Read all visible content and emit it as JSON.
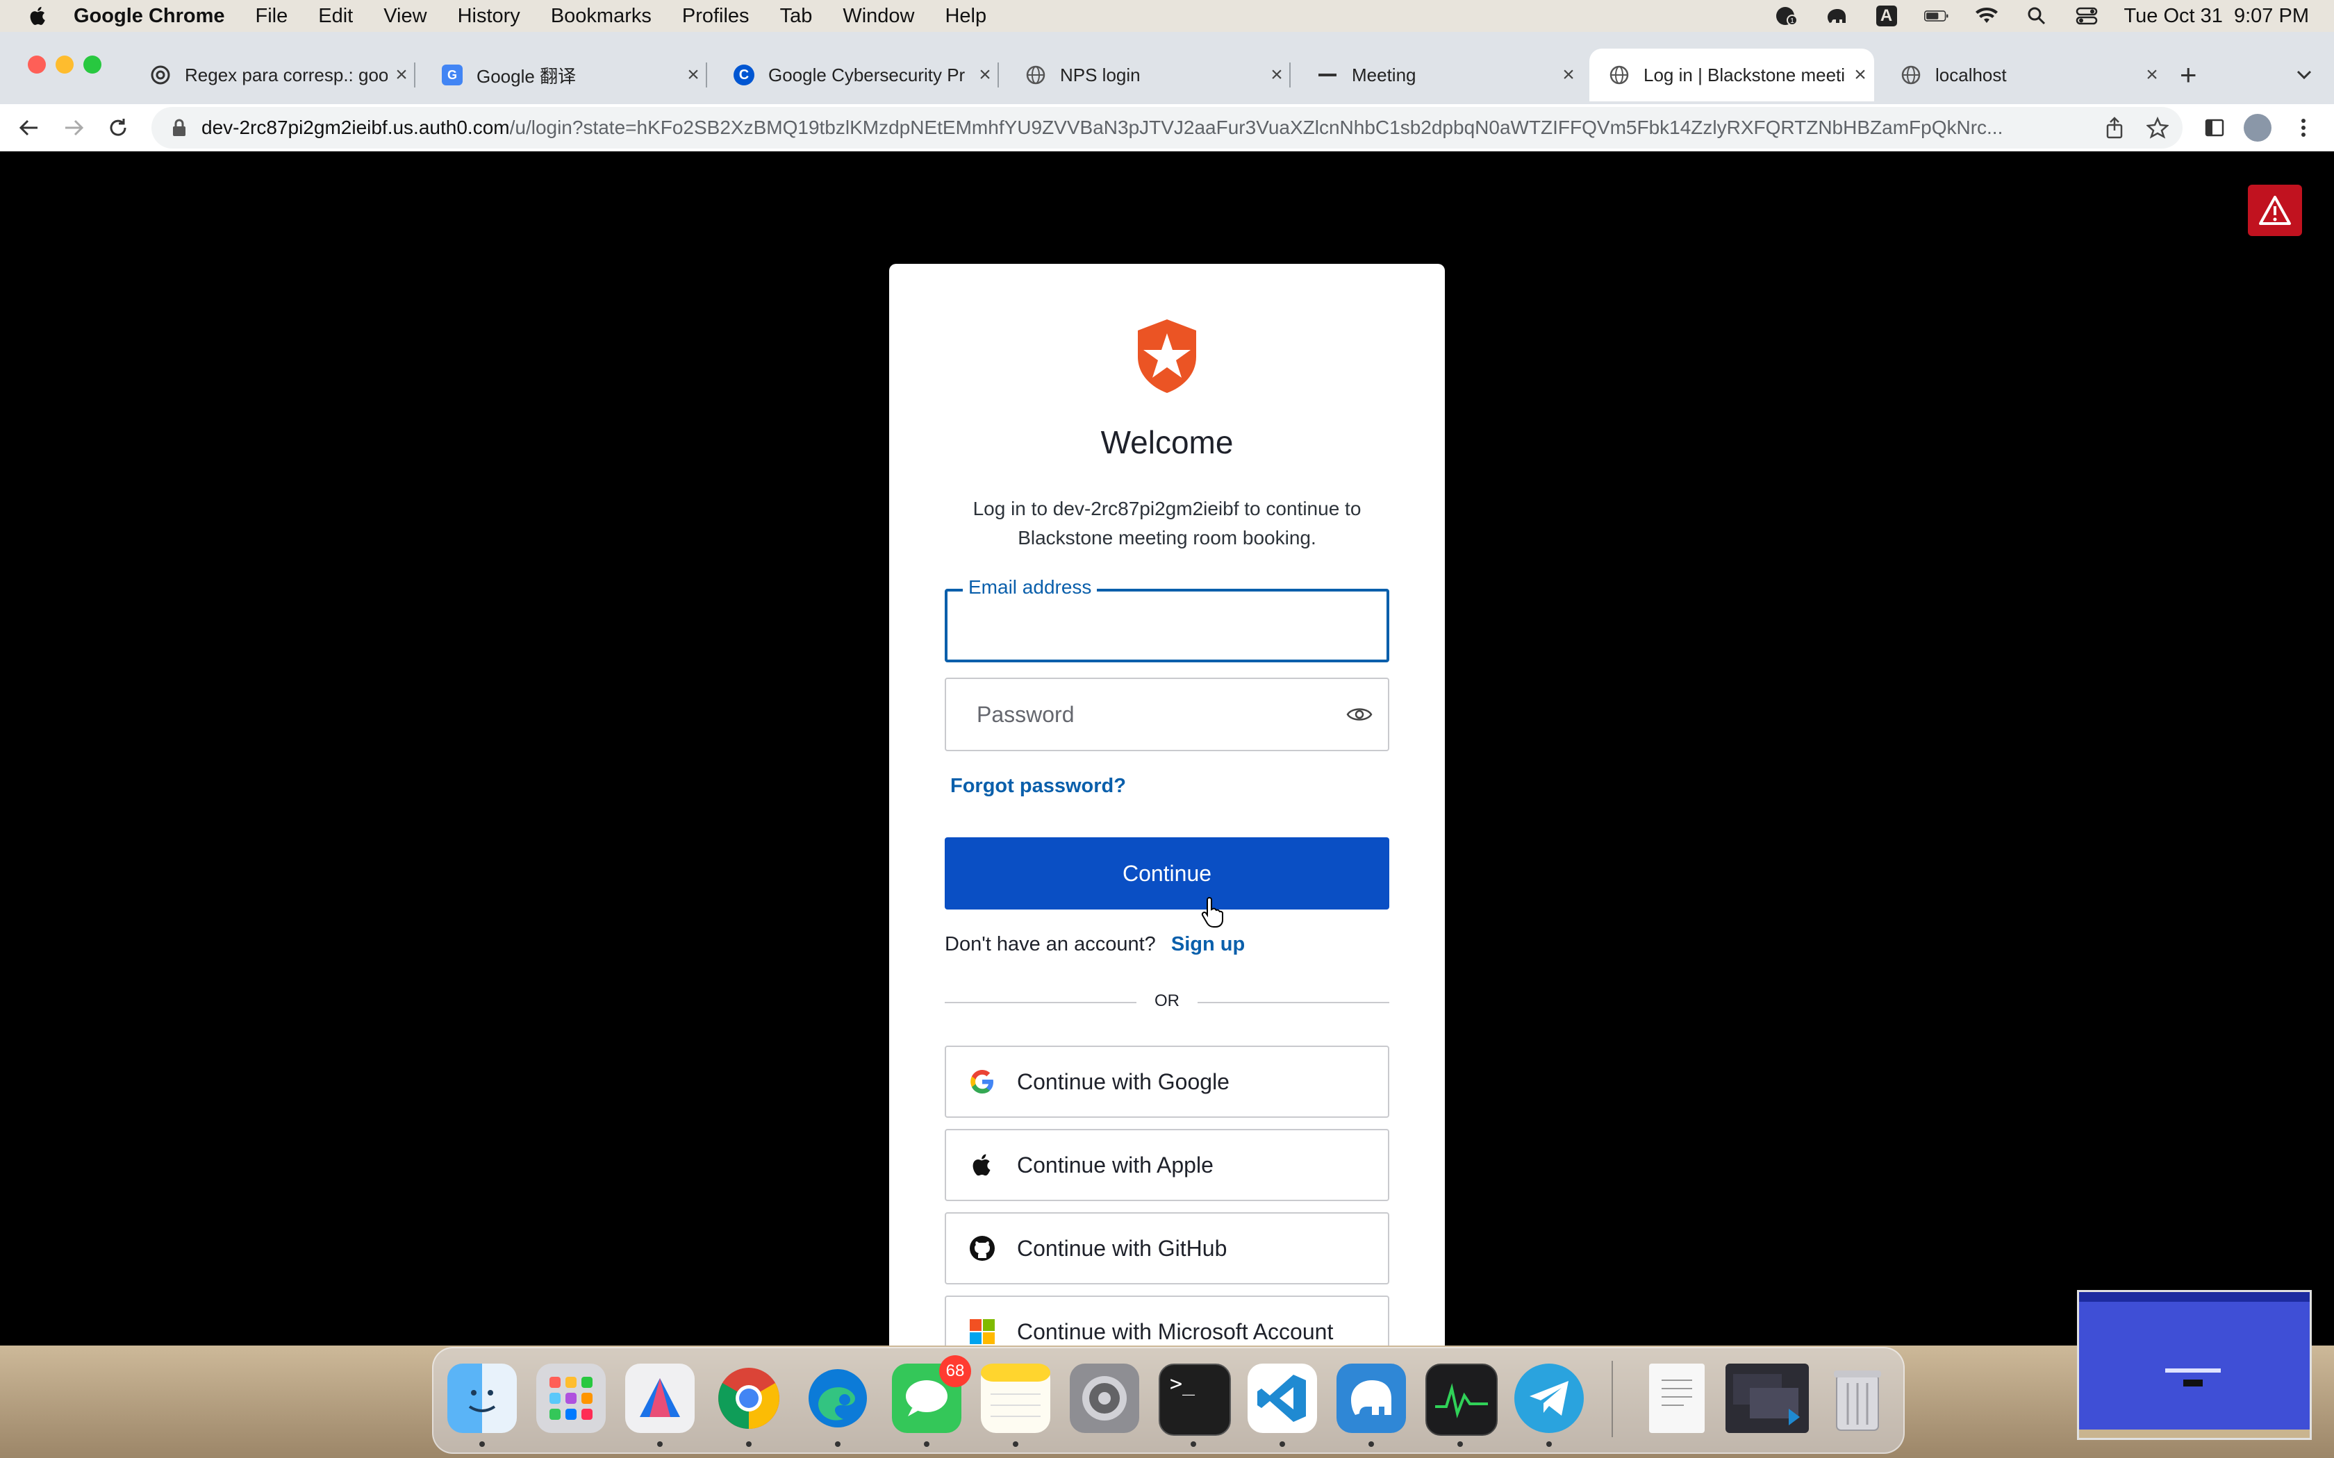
{
  "menubar": {
    "app_name": "Google Chrome",
    "items": [
      "File",
      "Edit",
      "View",
      "History",
      "Bookmarks",
      "Profiles",
      "Tab",
      "Window",
      "Help"
    ],
    "clock": "Tue Oct 31  9:07 PM",
    "input_source": "A"
  },
  "tabs": [
    {
      "label": "Regex para corresp.: goo",
      "icon": "chatgpt-icon",
      "active": false
    },
    {
      "label": "Google 翻译",
      "icon": "google-translate-icon",
      "active": false
    },
    {
      "label": "Google Cybersecurity Pr",
      "icon": "coursera-icon",
      "active": false
    },
    {
      "label": "NPS login",
      "icon": "globe-icon",
      "active": false
    },
    {
      "label": "Meeting",
      "icon": "line-icon",
      "active": false
    },
    {
      "label": "Log in | Blackstone meeti",
      "icon": "globe-icon",
      "active": true
    },
    {
      "label": "localhost",
      "icon": "globe-icon",
      "active": false
    }
  ],
  "address": {
    "host": "dev-2rc87pi2gm2ieibf.us.auth0.com",
    "path": "/u/login?state=hKFo2SB2XzBMQ19tbzlKMzdpNEtEMmhfYU9ZVVBaN3pJTVJ2aaFur3VuaXZlcnNhbC1sb2dpbqN0aWTZIFFQVm5Fbk14ZzlyRXFQRTZNbHBZamFpQkNrc..."
  },
  "login": {
    "title": "Welcome",
    "description": "Log in to dev-2rc87pi2gm2ieibf to continue to Blackstone meeting room booking.",
    "email_label": "Email address",
    "email_value": "",
    "password_placeholder": "Password",
    "forgot_link": "Forgot password?",
    "continue_label": "Continue",
    "no_account_text": "Don't have an account?",
    "signup_link": "Sign up",
    "or_text": "OR",
    "social": [
      {
        "label": "Continue with Google",
        "icon": "google-icon"
      },
      {
        "label": "Continue with Apple",
        "icon": "apple-icon"
      },
      {
        "label": "Continue with GitHub",
        "icon": "github-icon"
      },
      {
        "label": "Continue with Microsoft Account",
        "icon": "microsoft-icon"
      }
    ]
  },
  "dock": {
    "messages_badge": "68",
    "apps": [
      "Finder",
      "Launchpad",
      "Affinity Designer",
      "Google Chrome",
      "Microsoft Edge",
      "Messages",
      "Notes",
      "System Settings",
      "Terminal",
      "Visual Studio Code",
      "TablePlus",
      "Activity Monitor",
      "Telegram"
    ]
  },
  "colors": {
    "primary": "#0a4fc4",
    "link": "#0a5fab",
    "alert": "#c1121f",
    "auth0_logo": "#eb5424"
  }
}
